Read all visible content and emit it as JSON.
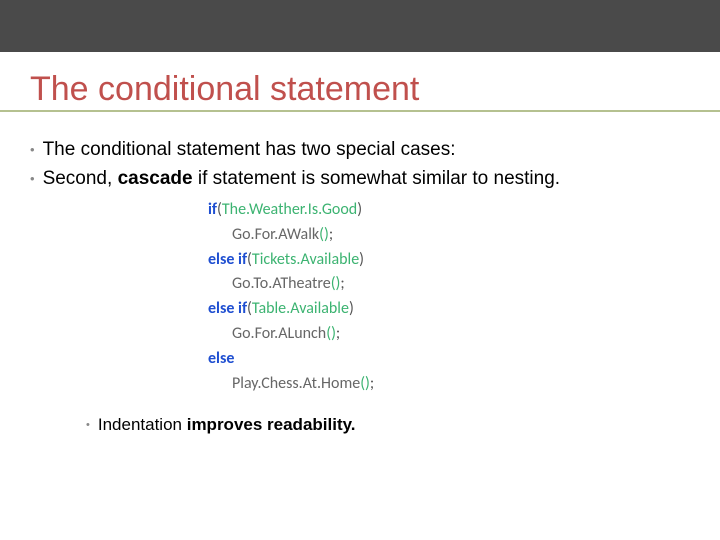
{
  "title": "The conditional statement",
  "bullets": [
    {
      "text": "The conditional statement has two special cases:"
    },
    {
      "pre": "Second, ",
      "bold": "cascade",
      "post": " if statement is somewhat similar to nesting."
    }
  ],
  "code": {
    "l1_kw": "if",
    "l1_cond": "The.Weather.Is.Good",
    "l2_stmt": "Go.For.AWalk",
    "l3_kw": "else if",
    "l3_cond": "Tickets.Available",
    "l4_stmt": "Go.To.ATheatre",
    "l5_kw": "else if",
    "l5_cond": "Table.Available",
    "l6_stmt": "Go.For.ALunch",
    "l7_kw": "else",
    "l8_stmt": "Play.Chess.At.Home"
  },
  "sub_bullet": {
    "pre": "Indentation ",
    "bold": "improves readability."
  }
}
